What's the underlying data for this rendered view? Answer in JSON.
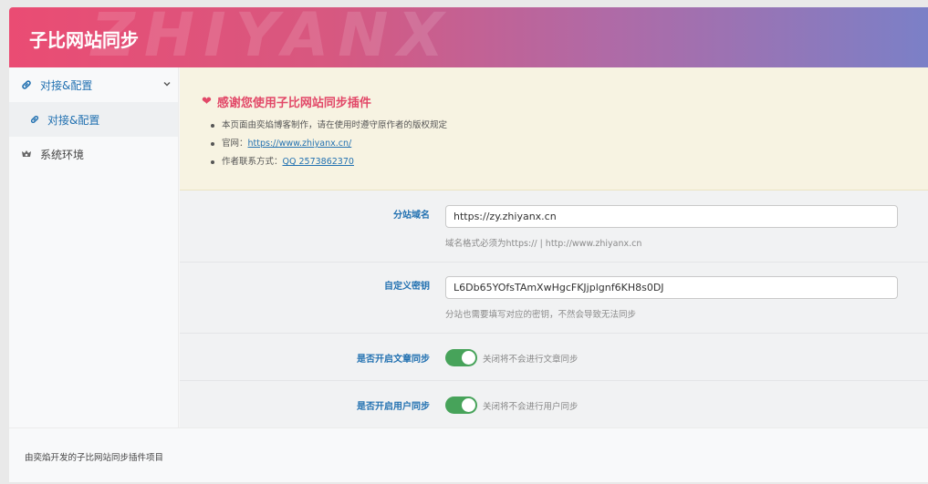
{
  "header": {
    "title": "子比网站同步",
    "watermark": "ZHIYANX"
  },
  "sidebar": {
    "parent": {
      "label": "对接&配置",
      "icon": "link-icon"
    },
    "child": {
      "label": "对接&配置",
      "icon": "link-icon"
    },
    "other": {
      "label": "系统环境",
      "icon": "settings-icon"
    }
  },
  "notice": {
    "heading": "感谢您使用子比网站同步插件",
    "items": {
      "line1": "本页面由奕焰博客制作，请在使用时遵守原作者的版权规定",
      "site_label": "官网：",
      "site_link": "https://www.zhiyanx.cn/",
      "contact_label": "作者联系方式：",
      "contact_link": "QQ 2573862370"
    }
  },
  "form": {
    "domain": {
      "label": "分站域名",
      "value": "https://zy.zhiyanx.cn",
      "desc": "域名格式必须为https:// | http://www.zhiyanx.cn"
    },
    "secret": {
      "label": "自定义密钥",
      "value": "L6Db65YOfsTAmXwHgcFKJjplgnf6KH8s0DJ",
      "desc": "分站也需要填写对应的密钥，不然会导致无法同步"
    },
    "sync_posts": {
      "label": "是否开启文章同步",
      "enabled": true,
      "desc": "关闭将不会进行文章同步"
    },
    "sync_users": {
      "label": "是否开启用户同步",
      "enabled": true,
      "desc": "关闭将不会进行用户同步"
    }
  },
  "footer": {
    "text": "由奕焰开发的子比网站同步插件项目"
  },
  "colors": {
    "accent": "#2271b1",
    "toggle_on": "#47a35a",
    "heading": "#e24868"
  }
}
